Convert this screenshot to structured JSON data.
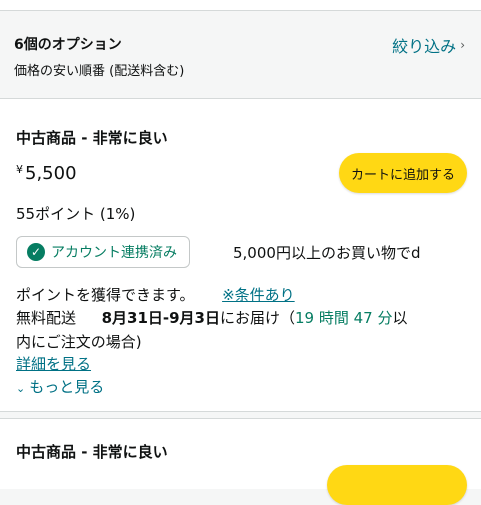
{
  "header": {
    "options_count": "6個のオプション",
    "sort_label": "価格の安い順番 (配送料含む)",
    "filter_label": "絞り込み"
  },
  "offers": [
    {
      "condition": "中古商品 - 非常に良い",
      "currency": "¥",
      "price": "5,500",
      "cart_button": "カートに追加する",
      "points": "55ポイント (1%)",
      "linked_badge": "アカウント連携済み",
      "promo_text": "5,000円以上のお買い物でd",
      "promo_text_2": "ポイントを獲得できます。",
      "conditions_link": "※条件あり",
      "delivery_prefix": "無料配送",
      "delivery_dates": "8月31日-9月3日",
      "delivery_suffix": "にお届け（",
      "countdown": "19 時間 47 分",
      "delivery_tail": "以",
      "delivery_line2": "内にご注文の場合)",
      "details_link": "詳細を見る",
      "more_link": "もっと見る"
    },
    {
      "condition": "中古商品 - 非常に良い"
    }
  ],
  "colors": {
    "link": "#007185",
    "accent_green": "#067d62",
    "cart_button": "#ffd814"
  }
}
